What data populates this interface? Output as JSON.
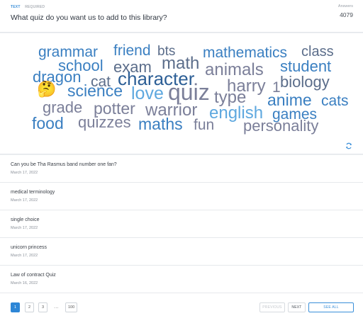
{
  "header": {
    "type_tag": "TEXT",
    "required_tag": "REQUIRED",
    "question": "What quiz do you want us to add to this library?",
    "answers_label": "Answers",
    "answers_count": "4079"
  },
  "cloud": {
    "words": {
      "grammar": "grammar",
      "friend": "friend",
      "bts": "bts",
      "mathematics": "mathematics",
      "class": "class",
      "school": "school",
      "exam": "exam",
      "math": "math",
      "animals": "animals",
      "student": "student",
      "dragon": "dragon",
      "cat": "cat",
      "character": "character",
      "harry": "harry",
      "one": "1",
      "biology": "biology",
      "science": "science",
      "love": "love",
      "quiz": "quiz",
      "type": "type",
      "anime": "anime",
      "cats": "cats",
      "grade": "grade",
      "potter": "potter",
      "warrior": "warrior",
      "english": "english",
      "games": "games",
      "food": "food",
      "quizzes": "quizzes",
      "maths": "maths",
      "fun": "fun",
      "personality": "personality"
    },
    "emoji": "🤔",
    "refresh_icon": "refresh-icon"
  },
  "responses": [
    {
      "title": "Can you be Tha Rasmus band number one fan?",
      "date": "March 17, 2022"
    },
    {
      "title": "medical terminology",
      "date": "March 17, 2022"
    },
    {
      "title": "single choice",
      "date": "March 17, 2022"
    },
    {
      "title": "unicorn princess",
      "date": "March 17, 2022"
    },
    {
      "title": "Law of contract Quiz",
      "date": "March 16, 2022"
    }
  ],
  "pagination": {
    "pages": [
      "1",
      "2",
      "3"
    ],
    "ellipsis": "...",
    "last": "100",
    "previous": "PREVIOUS",
    "next": "NEXT",
    "see_all": "SEE ALL"
  },
  "colors": {
    "accent": "#2d86d6",
    "cloud_blue": "#3a7fc1",
    "cloud_slate": "#5b6d8a",
    "cloud_light": "#5ea8df"
  }
}
